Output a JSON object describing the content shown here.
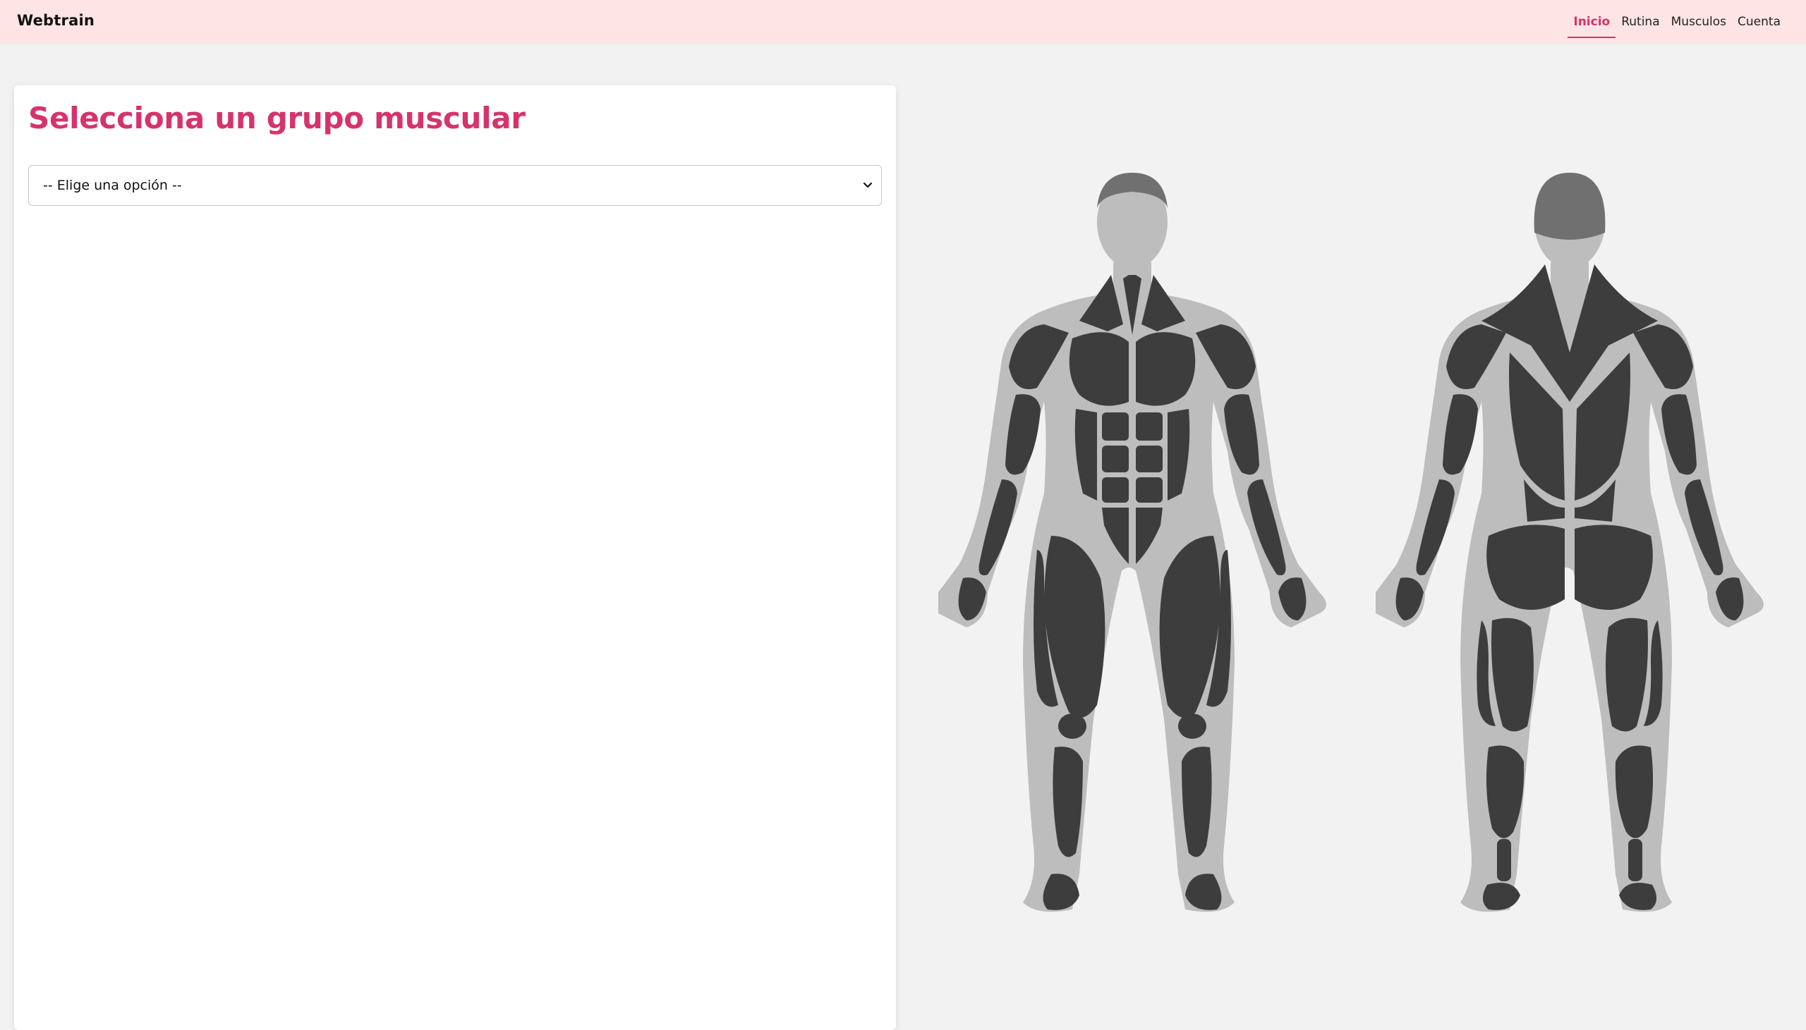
{
  "header": {
    "brand": "Webtrain",
    "nav": [
      {
        "label": "Inicio",
        "active": true
      },
      {
        "label": "Rutina",
        "active": false
      },
      {
        "label": "Musculos",
        "active": false
      },
      {
        "label": "Cuenta",
        "active": false
      }
    ]
  },
  "panel": {
    "title": "Selecciona un grupo muscular",
    "select": {
      "value": "-- Elige una opción --",
      "icon": "chevron-down-icon"
    }
  },
  "anatomy": {
    "views": [
      "front-body",
      "back-body"
    ]
  },
  "colors": {
    "accent": "#d6336c",
    "header_bg": "#fee4e5",
    "page_bg": "#f2f2f2",
    "muscle": "#3d3d3d",
    "body_outline": "#bdbdbd",
    "hair": "#707070"
  }
}
